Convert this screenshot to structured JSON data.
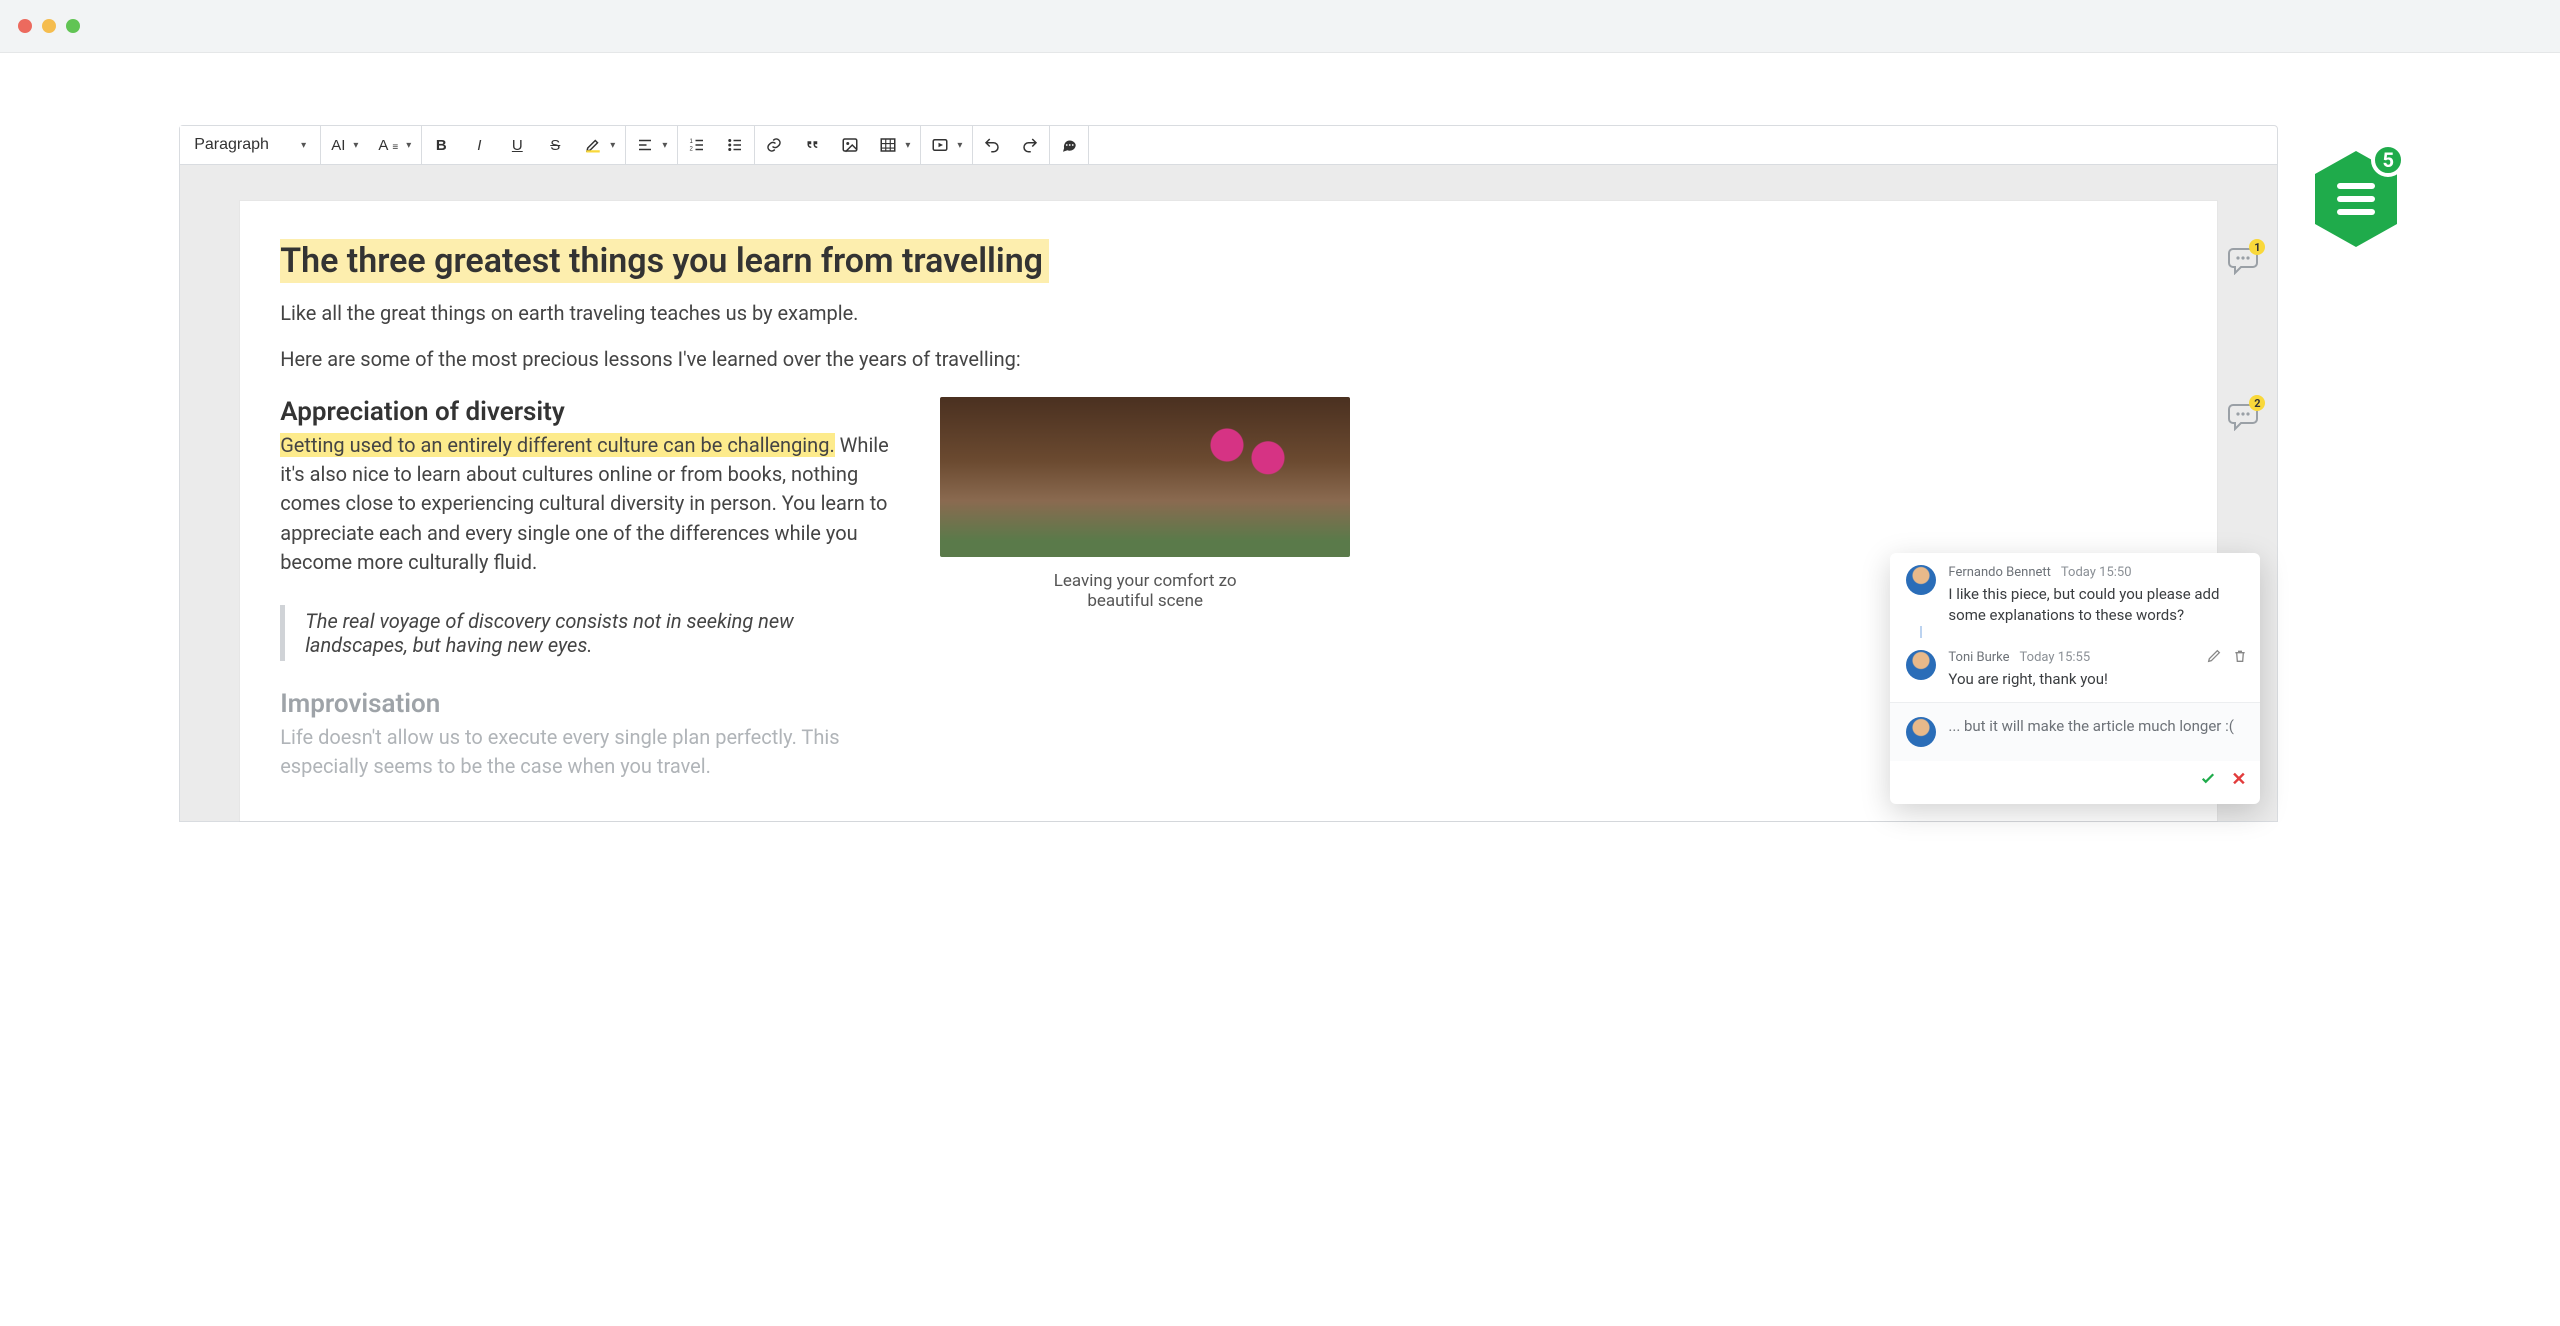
{
  "toolbar": {
    "heading_selector": "Paragraph",
    "buttons": {
      "ai": "AI",
      "font_size": "A≡",
      "bold": "B",
      "italic": "I",
      "underline": "U",
      "strike": "S",
      "highlight": "highlighter",
      "align": "align",
      "numbered_list": "ol",
      "bullet_list": "ul",
      "link": "link",
      "quote": "quote",
      "image": "image",
      "table": "table",
      "media": "media",
      "undo": "undo",
      "redo": "redo",
      "comment": "comment"
    }
  },
  "document": {
    "title": "The three greatest things you learn from travelling",
    "lead": "Like all the great things on earth traveling teaches us by example.",
    "lead2": "Here are some of the most precious lessons I've learned over the years of travelling:",
    "section1_title": "Appreciation of diversity",
    "section1_highlight": "Getting used to an entirely different culture can be challenging.",
    "section1_rest": " While it's also nice to learn about cultures online or from books, nothing comes close to experiencing cultural diversity in person. You learn to appreciate each and every single one of the differences while you become more culturally fluid.",
    "blockquote": "The real voyage of discovery consists not in seeking new landscapes, but having new eyes.",
    "section2_title": "Improvisation",
    "section2_body": "Life doesn't allow us to execute every single plan perfectly. This especially seems to be the case when you travel.",
    "figure_caption_line1": "Leaving your comfort zo",
    "figure_caption_line2": "beautiful scene"
  },
  "annotations": {
    "bubble1_count": "1",
    "bubble2_count": "2"
  },
  "thread": {
    "comments": [
      {
        "author": "Fernando Bennett",
        "time": "Today 15:50",
        "text": "I like this piece, but could you please add some explanations to these words?"
      },
      {
        "author": "Toni Burke",
        "time": "Today 15:55",
        "text": "You are right, thank you!"
      }
    ],
    "reply_draft": "... but it will make the article much longer :("
  },
  "floating_badge": {
    "count": "5"
  }
}
